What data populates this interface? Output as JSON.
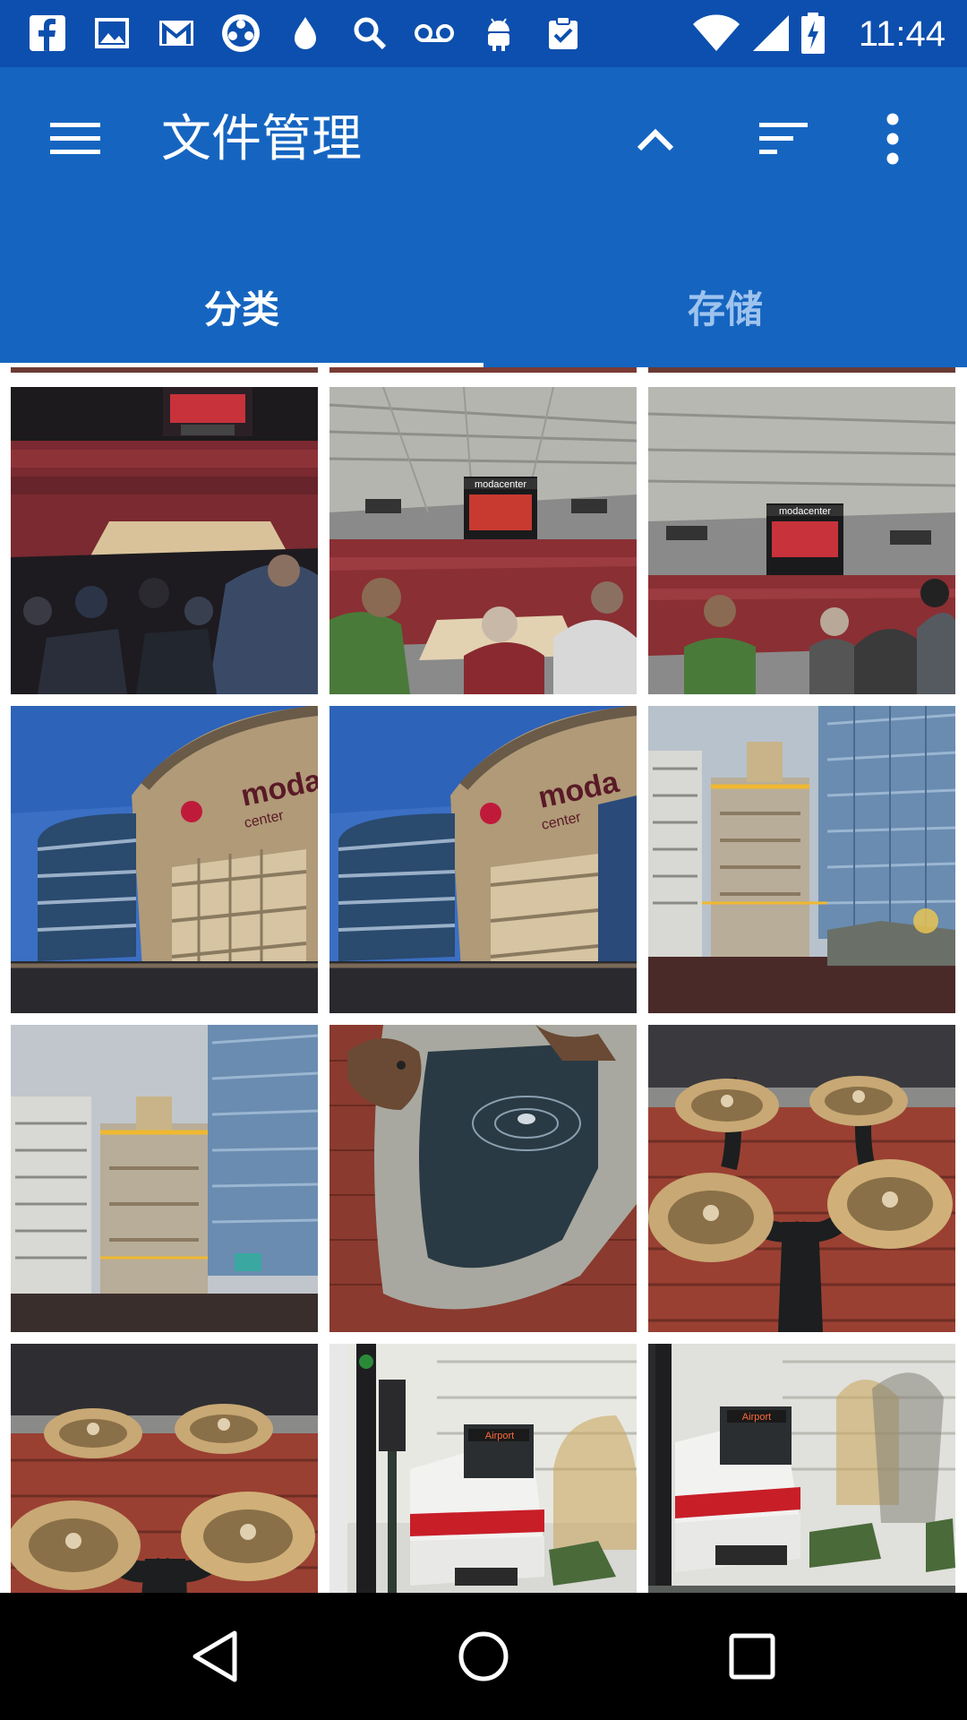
{
  "status_bar": {
    "time": "11:44",
    "notification_icons": [
      "facebook-icon",
      "image-icon",
      "gmail-icon",
      "game-controller-icon",
      "drop-icon",
      "search-icon",
      "voicemail-icon",
      "android-icon",
      "clipboard-check-icon"
    ],
    "system_icons": [
      "wifi-icon",
      "cell-signal-icon",
      "battery-charging-icon"
    ]
  },
  "app_bar": {
    "title": "文件管理",
    "icons": [
      "menu-icon",
      "chevron-up-icon",
      "sort-icon",
      "more-vert-icon"
    ],
    "background": "#1565c0"
  },
  "tabs": [
    {
      "label": "分类",
      "active": true
    },
    {
      "label": "存储",
      "active": false
    }
  ],
  "gallery": {
    "thumbnails": [
      {
        "subject": "arena-court-crowd"
      },
      {
        "subject": "arena-scoreboard-fans"
      },
      {
        "subject": "arena-scoreboard-fans"
      },
      {
        "subject": "moda-center-building"
      },
      {
        "subject": "moda-center-building"
      },
      {
        "subject": "city-towers"
      },
      {
        "subject": "city-towers"
      },
      {
        "subject": "beaver-fountain"
      },
      {
        "subject": "drinking-fountain"
      },
      {
        "subject": "drinking-fountain"
      },
      {
        "subject": "airport-train"
      },
      {
        "subject": "airport-train"
      }
    ],
    "visible_texts": {
      "moda_sign": "moda",
      "moda_sign_sub": "center",
      "modacenter_board": "modacenter",
      "train_sign": "Airport"
    }
  },
  "nav_bar": {
    "icons": [
      "back-icon",
      "home-icon",
      "recents-icon"
    ]
  },
  "colors": {
    "status_bar": "#0d4fae",
    "primary": "#1565c0",
    "tab_active": "#ffffff",
    "tab_inactive": "#9ec3ee",
    "nav_bar": "#000000"
  }
}
